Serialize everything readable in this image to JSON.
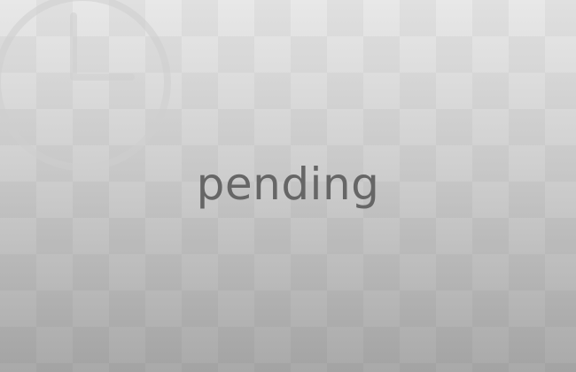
{
  "status": {
    "text": "pending"
  },
  "icon": {
    "name": "clock-icon"
  },
  "colors": {
    "text": "#666666",
    "icon_stroke": "#c9c9c9",
    "bg_top": "#e8e8e8",
    "bg_bottom": "#a9a9a9"
  }
}
